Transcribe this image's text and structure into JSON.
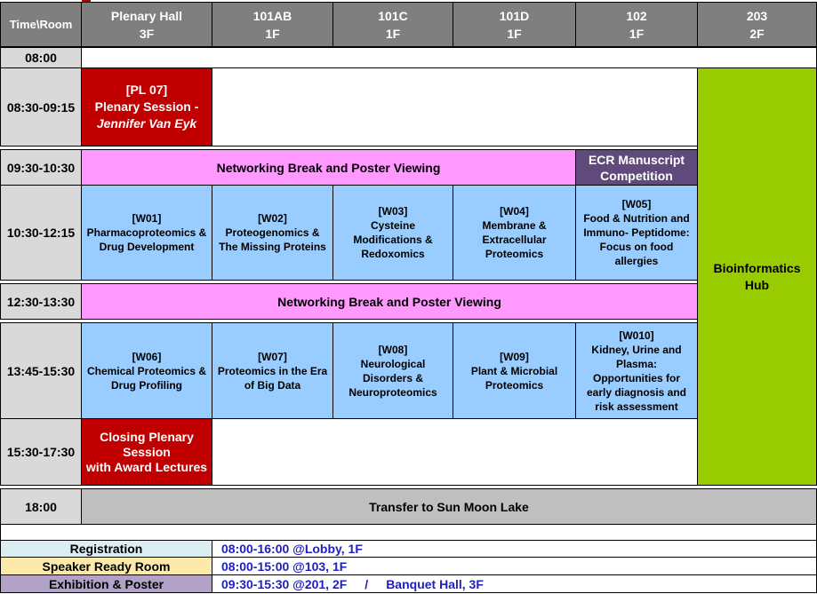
{
  "header": {
    "corner": "Time\\Room",
    "rooms": [
      {
        "name": "Plenary Hall",
        "floor": "3F"
      },
      {
        "name": "101AB",
        "floor": "1F"
      },
      {
        "name": "101C",
        "floor": "1F"
      },
      {
        "name": "101D",
        "floor": "1F"
      },
      {
        "name": "102",
        "floor": "1F"
      },
      {
        "name": "203",
        "floor": "2F"
      }
    ]
  },
  "times": [
    "08:00",
    "08:30-09:15",
    "09:30-10:30",
    "10:30-12:15",
    "12:30-13:30",
    "13:45-15:30",
    "15:30-17:30",
    "18:00"
  ],
  "sessions": {
    "pl07": {
      "code": "[PL 07]",
      "title": "Plenary Session -",
      "speaker": "Jennifer Van Eyk"
    },
    "break1": "Networking Break and Poster Viewing",
    "ecr": {
      "line1": "ECR Manuscript",
      "line2": "Competition"
    },
    "w01": {
      "code": "[W01]",
      "line1": "Pharmacoproteomics &",
      "line2": "Drug Development"
    },
    "w02": {
      "code": "[W02]",
      "line1": "Proteogenomics &",
      "line2": "The Missing Proteins"
    },
    "w03": {
      "code": "[W03]",
      "line1": "Cysteine",
      "line2": "Modifications &",
      "line3": "Redoxomics"
    },
    "w04": {
      "code": "[W04]",
      "line1": "Membrane &",
      "line2": "Extracellular",
      "line3": "Proteomics"
    },
    "w05": {
      "code": "[W05]",
      "line1": "Food & Nutrition and",
      "line2": "Immuno- Peptidome:",
      "line3": "Focus on food",
      "line4": "allergies"
    },
    "break2": "Networking Break and Poster Viewing",
    "w06": {
      "code": "[W06]",
      "line1": "Chemical Proteomics &",
      "line2": "Drug Profiling"
    },
    "w07": {
      "code": "[W07]",
      "line1": "Proteomics in the Era",
      "line2": "of Big Data"
    },
    "w08": {
      "code": "[W08]",
      "line1": "Neurological",
      "line2": "Disorders &",
      "line3": "Neuroproteomics"
    },
    "w09": {
      "code": "[W09]",
      "line1": "Plant & Microbial",
      "line2": "Proteomics"
    },
    "w010": {
      "code": "[W010]",
      "line1": "Kidney, Urine and",
      "line2": "Plasma:",
      "line3": "Opportunities for",
      "line4": "early diagnosis and",
      "line5": "risk assessment"
    },
    "closing": {
      "line1": "Closing Plenary",
      "line2": "Session",
      "line3": "with Award Lectures"
    },
    "bioinfo": {
      "line1": "Bioinformatics",
      "line2": "Hub"
    },
    "transfer": "Transfer to Sun Moon Lake"
  },
  "info": {
    "registration": {
      "label": "Registration",
      "value": "08:00-16:00 @Lobby, 1F"
    },
    "speaker_ready": {
      "label": "Speaker Ready Room",
      "value": "08:00-15:00 @103, 1F"
    },
    "exhibition": {
      "label": "Exhibition & Poster",
      "value": "09:30-15:30 @201, 2F",
      "separator": "/",
      "value2": "Banquet Hall, 3F"
    }
  },
  "colors": {
    "header": "#7f7f7f",
    "time": "#d9d9d9",
    "plenary": "#c00000",
    "break": "#ff99ff",
    "ecr": "#604a7b",
    "workshop": "#99ccff",
    "bioinformatics": "#99cc00",
    "transfer": "#bfbfbf",
    "registration": "#dbeef3",
    "speaker_ready": "#fde9a9",
    "exhibition": "#b3a2c7",
    "info_text": "#1f1fbf"
  }
}
